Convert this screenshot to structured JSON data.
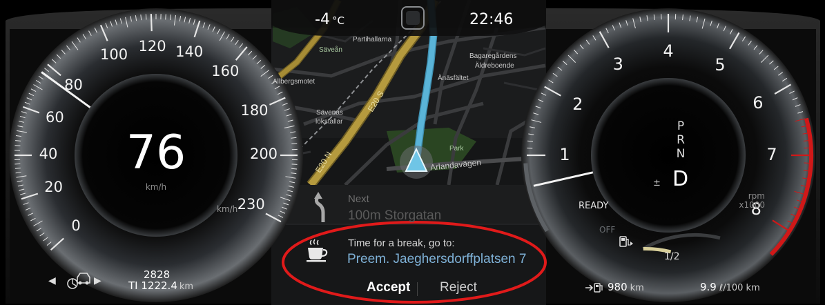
{
  "status_bar": {
    "temperature": "-4",
    "temperature_unit": "°C",
    "time": "22:46"
  },
  "speedometer": {
    "speed": "76",
    "unit": "km/h",
    "scale_unit": "km/h",
    "tick_labels": [
      "0",
      "20",
      "40",
      "60",
      "80",
      "100",
      "120",
      "140",
      "160",
      "180",
      "200",
      "230"
    ],
    "needle_value": 76
  },
  "tachometer": {
    "tick_labels": [
      "1",
      "2",
      "3",
      "4",
      "5",
      "6",
      "7",
      "8"
    ],
    "unit_line1": "rpm",
    "unit_line2": "x1000",
    "needle_value": 0.6,
    "ready_label": "READY",
    "off_label": "OFF",
    "gear_options": [
      "P",
      "R",
      "N"
    ],
    "gear_current": "D",
    "gear_manual_symbol": "±",
    "fuel_half_label": "1/2",
    "fuel_level": 0.35
  },
  "map": {
    "labels": {
      "partihallarna": "Partihallarna",
      "savean": "Säveån",
      "bagaregardens": "Bagaregårdens",
      "aldreboende": "Äldreboende",
      "allbergsmotet": "Allbergsmotet",
      "anasfaltet": "Änäsfältet",
      "savenas": "Sävenäs",
      "lokstallar": "lokstallar",
      "e20s": "E20 S",
      "e20n": "E20 N",
      "park": "Park",
      "arlandavagen": "Arlandavägen"
    }
  },
  "navigation": {
    "next_label": "Next",
    "next_instruction": "100m Storgatan"
  },
  "notification": {
    "message": "Time for a break, go to:",
    "destination": "Preem. Jaeghersdorffplatsen 7",
    "accept_label": "Accept",
    "reject_label": "Reject",
    "icon": "coffee-cup-icon"
  },
  "bottom_left": {
    "odometer": "2828",
    "trip_label": "TI",
    "trip_value": "1222.4",
    "trip_unit": "km",
    "icon": "driver-assist-icon"
  },
  "bottom_right": {
    "range_value": "980",
    "range_unit": "km",
    "consumption_value": "9.9",
    "consumption_unit": "ℓ/100 km",
    "icon": "fuel-range-icon"
  },
  "colors": {
    "route": "#5ab4d8",
    "highway": "#b59a3e",
    "accent_red": "#d01818",
    "fuel_bar": "#d8cf9a"
  }
}
